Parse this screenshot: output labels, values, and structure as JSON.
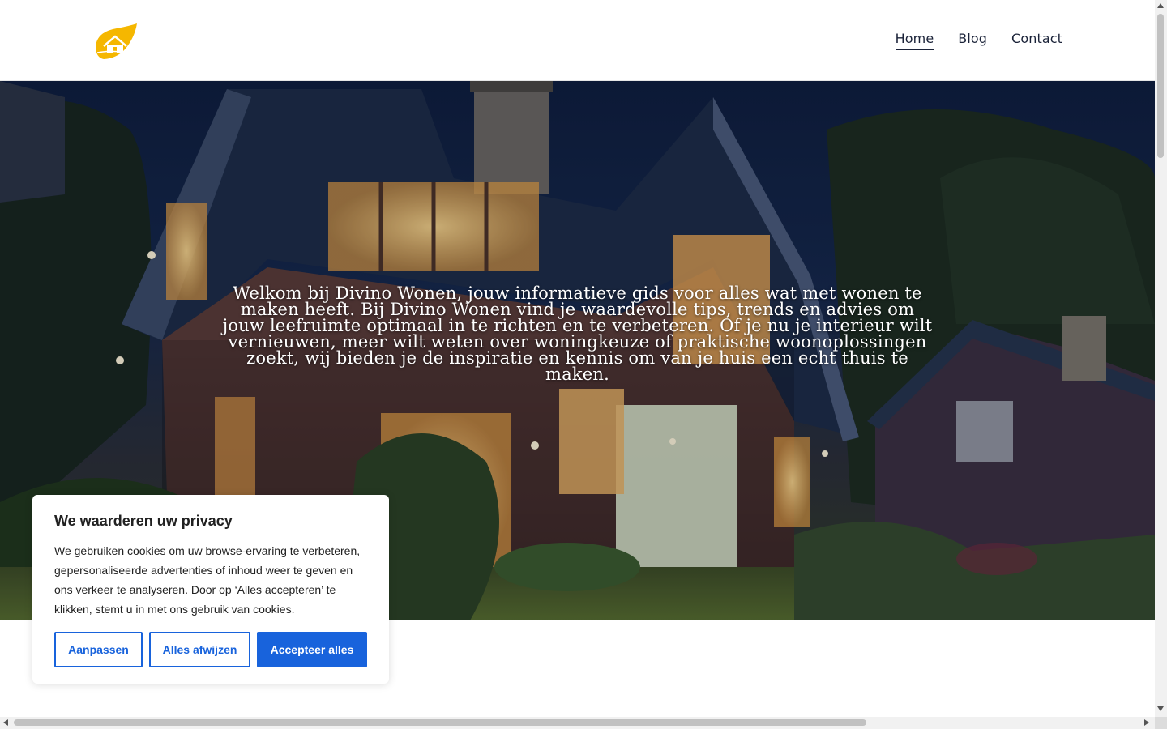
{
  "header": {
    "nav": [
      {
        "label": "Home",
        "active": true
      },
      {
        "label": "Blog",
        "active": false
      },
      {
        "label": "Contact",
        "active": false
      }
    ],
    "brand_color": "#f5b700"
  },
  "hero": {
    "text": "Welkom bij Divino Wonen, jouw informatieve gids voor alles wat met wonen te maken heeft. Bij Divino Wonen vind je waardevolle tips, trends en advies om jouw leefruimte optimaal in te richten en te verbeteren. Of je nu je interieur wilt vernieuwen, meer wilt weten over woningkeuze of praktische woonoplossingen zoekt, wij bieden je de inspiratie en kennis om van je huis een echt thuis te maken.",
    "image_icon": "house-photo"
  },
  "cookie": {
    "title": "We waarderen uw privacy",
    "text": "We gebruiken cookies om uw browse-ervaring te verbeteren, gepersonaliseerde advertenties of inhoud weer te geven en ons verkeer te analyseren. Door op ‘Alles accepteren’ te klikken, stemt u in met ons gebruik van cookies.",
    "buttons": {
      "customize": "Aanpassen",
      "reject": "Alles afwijzen",
      "accept": "Accepteer alles"
    },
    "accent_color": "#1863dc"
  }
}
